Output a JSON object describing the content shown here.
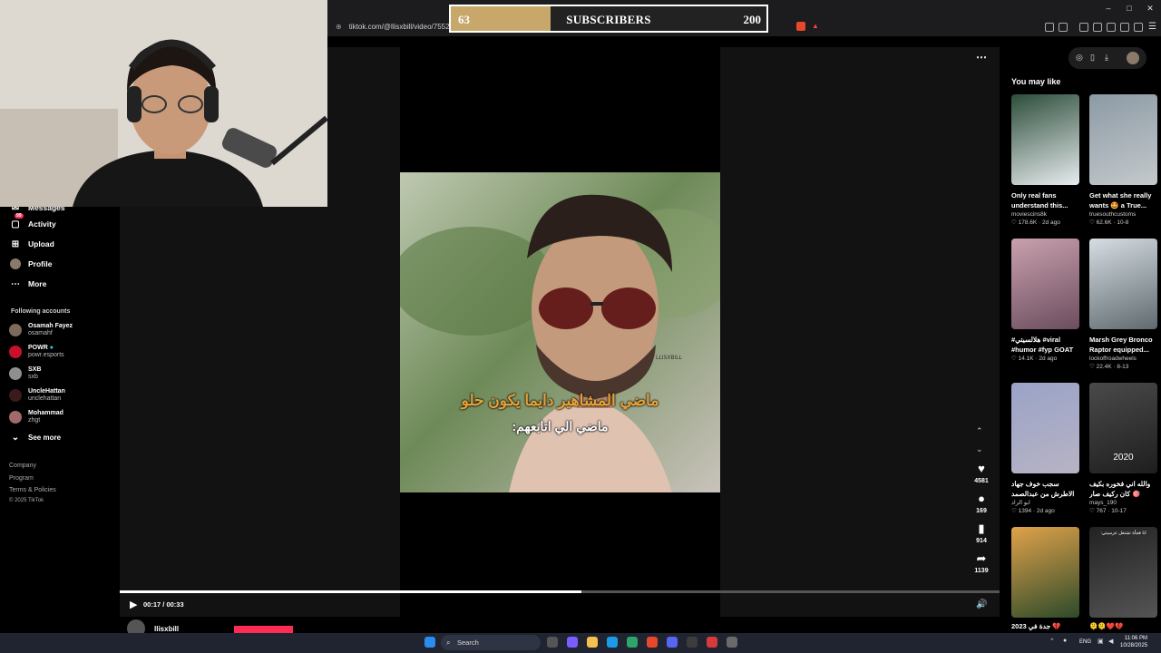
{
  "browser": {
    "url": "tiktok.com/@llisxbill/video/755218",
    "window_controls": [
      "–",
      "□",
      "✕"
    ]
  },
  "subscribers_bar": {
    "current": "63",
    "label": "SUBSCRIBERS",
    "goal": "200",
    "progress_fraction": 0.315,
    "fill_color": "#c8a76a"
  },
  "sidebar": {
    "items": [
      {
        "label": "Messages",
        "icon": "message-icon"
      },
      {
        "label": "Activity",
        "icon": "activity-icon",
        "badge": "99"
      },
      {
        "label": "Upload",
        "icon": "upload-icon"
      },
      {
        "label": "Profile",
        "icon": "profile-avatar"
      },
      {
        "label": "More",
        "icon": "more-icon"
      }
    ],
    "following_title": "Following accounts",
    "accounts": [
      {
        "name": "Osamah Fayez",
        "handle": "osamahf"
      },
      {
        "name": "POWR",
        "handle": "powr.esports"
      },
      {
        "name": "SXB",
        "handle": "sxb"
      },
      {
        "name": "UncleHattan",
        "handle": "unclehattan"
      },
      {
        "name": "Mohammad",
        "handle": "zhgt"
      }
    ],
    "see_more": "See more",
    "footer": [
      "Company",
      "Program",
      "Terms & Policies",
      "© 2025 TikTok"
    ]
  },
  "video": {
    "caption_line1": "ماضي المشاهير دايما يكون حلو",
    "caption_line2": "ماضي الي اتابعهم:",
    "watermark": "LLISXBILL",
    "time_current": "00:17",
    "time_total": "00:33",
    "progress_fraction": 0.525,
    "creator": "llisxbill"
  },
  "actions": {
    "likes": "4581",
    "comments": "169",
    "saves": "914",
    "shares": "1139"
  },
  "recommendations": {
    "title": "You may like",
    "cards": [
      {
        "caption": "Only real fans understand this...",
        "author": "moviescins8k",
        "stats": "♡ 178.6K · 2d ago",
        "c1": "#2c4d3a",
        "c2": "#e8ecef"
      },
      {
        "caption": "Get what she really wants 🤩 a True...",
        "author": "truesouthcustoms",
        "stats": "♡ 62.6K · 10-8",
        "c1": "#8c9aa4",
        "c2": "#c4c9cc"
      },
      {
        "caption": "#هلالسيتي #viral #humor #fyp GOAT 🐐",
        "author": "",
        "stats": "♡ 14.1K · 2d ago",
        "c1": "#c9a0ae",
        "c2": "#6b4d5e"
      },
      {
        "caption": "Marsh Grey Bronco Raptor equipped...",
        "author": "lockoffroadwheels",
        "stats": "♡ 22.4K · 8-13",
        "c1": "#d6dde3",
        "c2": "#5f6a6f"
      },
      {
        "caption": "سجب خوف جهاد الاطرش من عبدالصمد 😂😂...",
        "author": "ابو الزاد",
        "stats": "♡ 1394 · 2d ago",
        "c1": "#9aa3c7",
        "c2": "#b7b3c4"
      },
      {
        "caption": "والله اني فخوره بكيف كان ركيف صار 🎯 #kick...",
        "author": "mays_190",
        "stats": "♡ 767 · 10-17",
        "c1": "#4a4a4a",
        "c2": "#1e1e1e",
        "overlay": "2020"
      },
      {
        "caption": "2023 جدة في 💔",
        "author": "",
        "stats": "",
        "c1": "#e0a24a",
        "c2": "#2d4a2a"
      },
      {
        "caption": "🫠🫠❤️💔",
        "author": "",
        "stats": "",
        "c1": "#222",
        "c2": "#555",
        "overlay_top": "انا فجأة تشتغل عرسيتي:"
      }
    ]
  },
  "taskbar": {
    "search_placeholder": "Search",
    "lang": "ENG",
    "time": "11:06 PM",
    "date": "10/28/2025"
  }
}
